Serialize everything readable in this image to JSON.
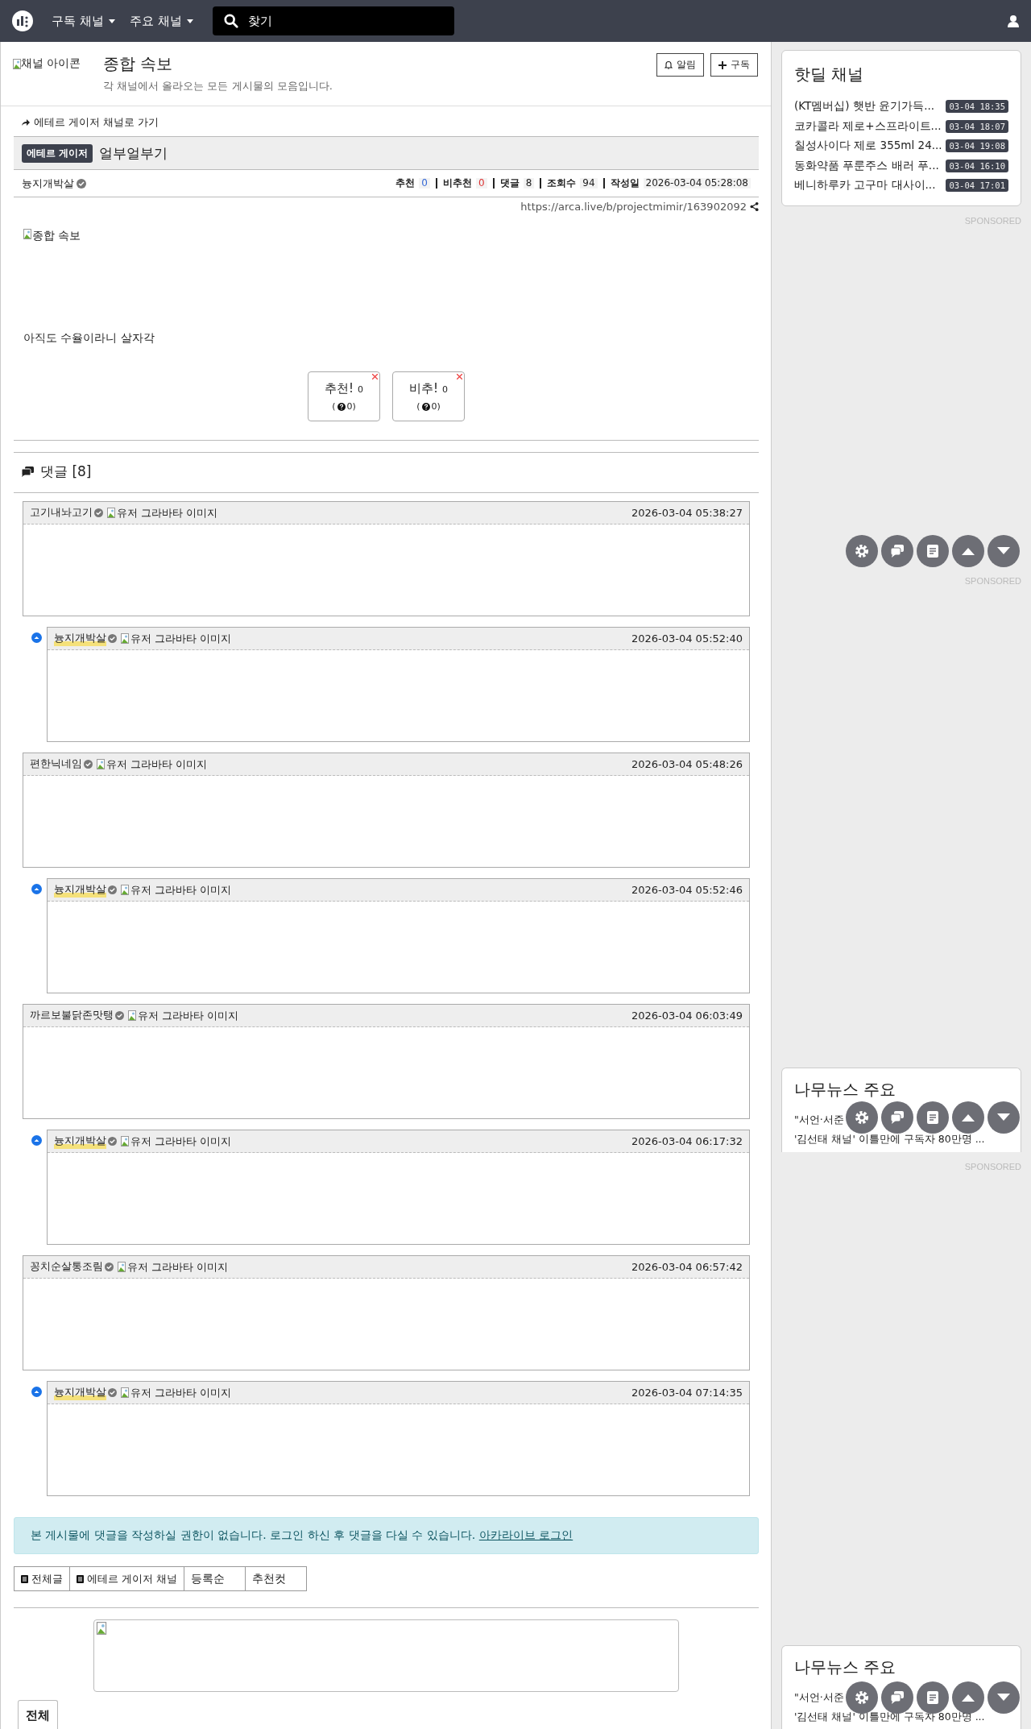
{
  "navbar": {
    "menus": [
      {
        "label": "구독 채널"
      },
      {
        "label": "주요 채널"
      }
    ],
    "search": {
      "placeholder": "찾기"
    }
  },
  "channel": {
    "icon_alt": "채널 아이콘",
    "title": "종합 속보",
    "description": "각 채널에서 올라오는 모든 게시물의 모음입니다.",
    "buttons": [
      {
        "label": "알림",
        "kind": "bell"
      },
      {
        "label": "구독",
        "kind": "plus"
      }
    ]
  },
  "post": {
    "back_link": "에테르 게이저 채널로 가기",
    "category": "에테르 게이저",
    "title": "얼부얼부기",
    "author": "늉지개박살",
    "stats": [
      {
        "label": "추천",
        "value": "0",
        "kind": "up"
      },
      {
        "label": "비추천",
        "value": "0",
        "kind": "down"
      },
      {
        "label": "댓글",
        "value": "8",
        "kind": "plain"
      },
      {
        "label": "조회수",
        "value": "94",
        "kind": "plain"
      },
      {
        "label": "작성일",
        "value": "2026-03-04 05:28:08",
        "kind": "plain"
      }
    ],
    "url": "https://arca.live/b/projectmimir/163902092",
    "image_alt": "종합 속보",
    "body": "아직도 수율이라니 살자각",
    "votes": [
      {
        "label": "추천!",
        "count": "0",
        "sub_open": "(",
        "sub": "0)"
      },
      {
        "label": "비추!",
        "count": "0",
        "sub_open": "(",
        "sub": "0)"
      }
    ]
  },
  "comments": {
    "title": "댓글 [8]",
    "items": [
      {
        "kind": "comment",
        "author": "고기내놔고기",
        "is_post_author": false,
        "avatar_alt": "유저 그라바타 이미지",
        "time": "2026-03-04 05:38:27"
      },
      {
        "kind": "reply",
        "author": "늉지개박살",
        "is_post_author": true,
        "avatar_alt": "유저 그라바타 이미지",
        "time": "2026-03-04 05:52:40"
      },
      {
        "kind": "comment",
        "author": "편한닉네임",
        "is_post_author": false,
        "avatar_alt": "유저 그라바타 이미지",
        "time": "2026-03-04 05:48:26"
      },
      {
        "kind": "reply",
        "author": "늉지개박살",
        "is_post_author": true,
        "avatar_alt": "유저 그라바타 이미지",
        "time": "2026-03-04 05:52:46"
      },
      {
        "kind": "comment",
        "author": "까르보불닭존맛탱",
        "is_post_author": false,
        "avatar_alt": "유저 그라바타 이미지",
        "time": "2026-03-04 06:03:49"
      },
      {
        "kind": "reply",
        "author": "늉지개박살",
        "is_post_author": true,
        "avatar_alt": "유저 그라바타 이미지",
        "time": "2026-03-04 06:17:32"
      },
      {
        "kind": "comment",
        "author": "꽁치순살통조림",
        "is_post_author": false,
        "avatar_alt": "유저 그라바타 이미지",
        "time": "2026-03-04 06:57:42"
      },
      {
        "kind": "reply",
        "author": "늉지개박살",
        "is_post_author": true,
        "avatar_alt": "유저 그라바타 이미지",
        "time": "2026-03-04 07:14:35"
      }
    ]
  },
  "notice": {
    "text": "본 게시물에 댓글을 작성하실 권한이 없습니다. 로그인 하신 후 댓글을 다실 수 있습니다.",
    "link": "아카라이브 로그인"
  },
  "list_buttons": [
    {
      "label": "전체글",
      "kind": "icon"
    },
    {
      "label": "에테르 게이저 채널",
      "kind": "icon"
    },
    {
      "label": "등록순",
      "kind": "plain"
    },
    {
      "label": "추천컷",
      "kind": "plain"
    }
  ],
  "bottom_tabs": [
    {
      "label": "전체",
      "selected": true
    }
  ],
  "sidebar": {
    "hotdeal": {
      "title": "핫딜 채널",
      "items": [
        {
          "title": "(KT멤버십) 햇반 윤기가득...",
          "time": "03-04 18:35"
        },
        {
          "title": "코카콜라 제로+스프라이트...",
          "time": "03-04 18:07"
        },
        {
          "title": "칠성사이다 제로 355ml 24...",
          "time": "03-04 19:08"
        },
        {
          "title": "동화약품 푸룬주스 배러 푸...",
          "time": "03-04 16:10"
        },
        {
          "title": "베니하루카 고구마 대사이...",
          "time": "03-04 17:01"
        }
      ]
    },
    "sponsored": [
      "SPONSORED",
      "SPONSORED",
      "SPONSORED"
    ],
    "news": [
      {
        "title": "나무뉴스 주요",
        "items": [
          "\"서언·서준",
          "'김선태 채널' 이틀만에 구독자 80만명 ..."
        ]
      },
      {
        "title": "나무뉴스 주요",
        "items": [
          "\"서언·서준",
          "'김선태 채널' 이틀만에 구독자 80만명 ..."
        ]
      }
    ]
  }
}
